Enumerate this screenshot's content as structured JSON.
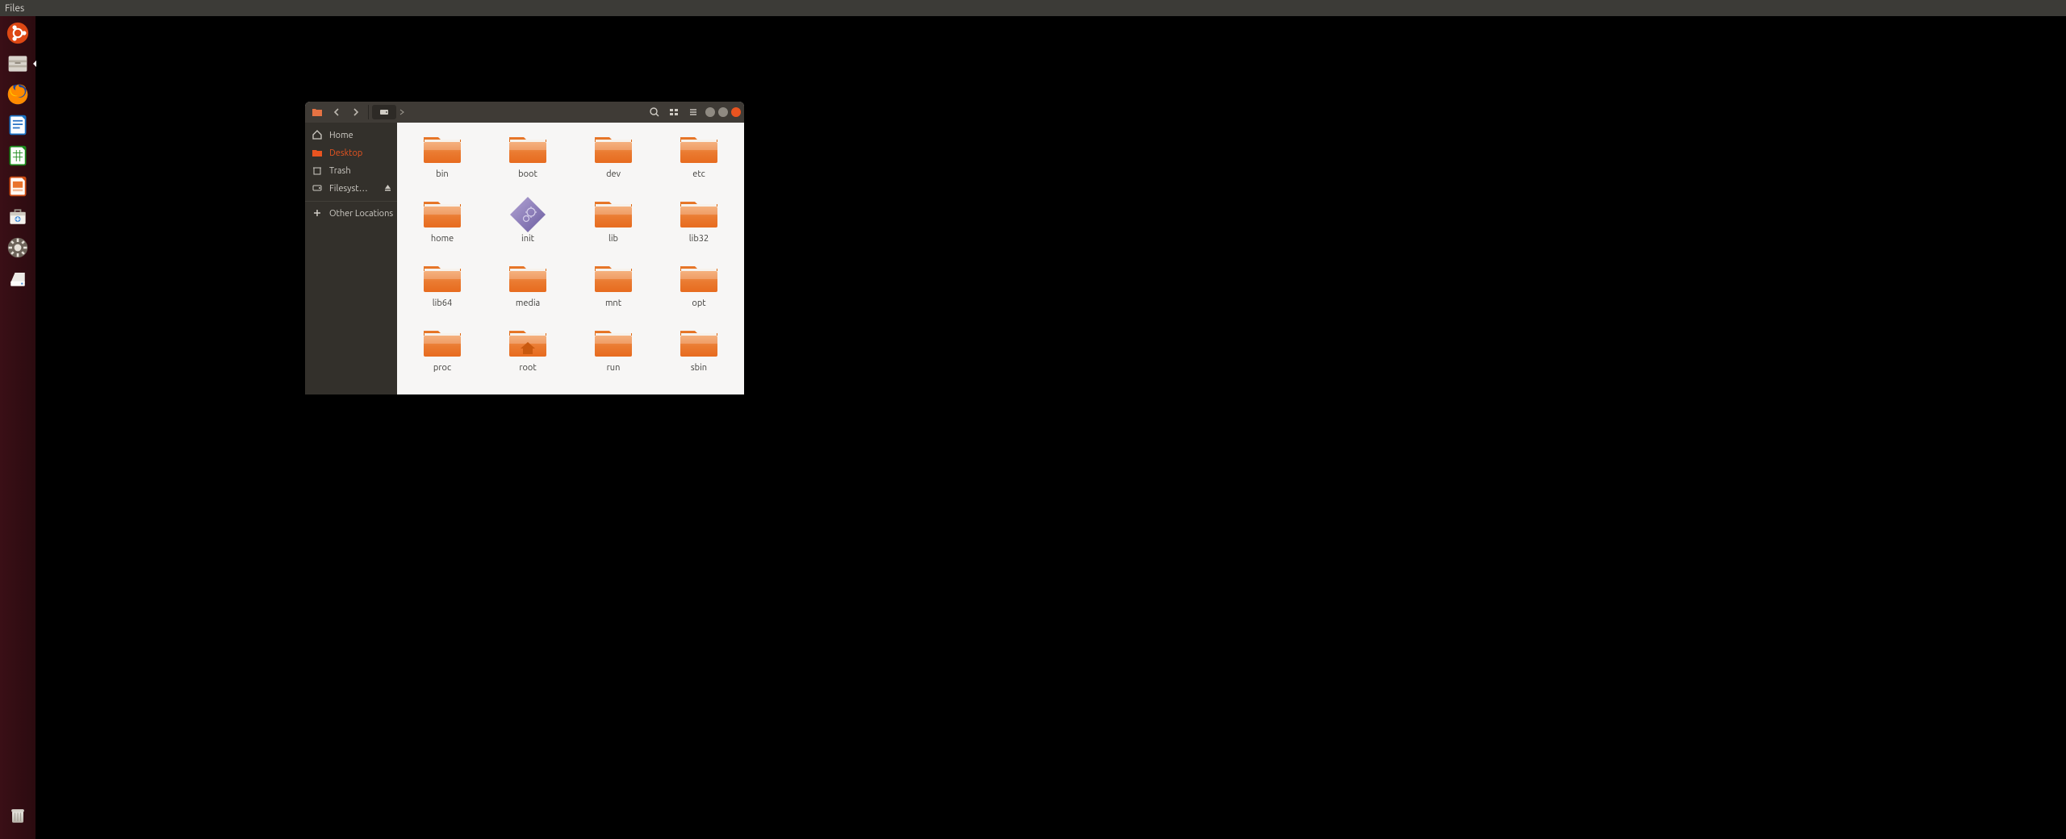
{
  "menubar": {
    "app": "Files"
  },
  "launcher": {
    "items": [
      {
        "name": "ubuntu-dash"
      },
      {
        "name": "files",
        "selected": true
      },
      {
        "name": "firefox"
      },
      {
        "name": "libreoffice-writer"
      },
      {
        "name": "libreoffice-calc"
      },
      {
        "name": "libreoffice-impress"
      },
      {
        "name": "ubuntu-software"
      },
      {
        "name": "settings"
      },
      {
        "name": "disk"
      }
    ],
    "bottom": {
      "name": "trash"
    }
  },
  "fm": {
    "sidebar": {
      "items": [
        {
          "icon": "home",
          "label": "Home"
        },
        {
          "icon": "desktop",
          "label": "Desktop",
          "active": true
        },
        {
          "icon": "trash",
          "label": "Trash"
        },
        {
          "icon": "drive",
          "label": "Filesyst…",
          "eject": true
        },
        {
          "icon": "plus",
          "label": "Other Locations"
        }
      ]
    },
    "folders": [
      {
        "label": "bin",
        "kind": "folder"
      },
      {
        "label": "boot",
        "kind": "folder"
      },
      {
        "label": "dev",
        "kind": "folder"
      },
      {
        "label": "etc",
        "kind": "folder"
      },
      {
        "label": "home",
        "kind": "folder"
      },
      {
        "label": "init",
        "kind": "exec"
      },
      {
        "label": "lib",
        "kind": "folder"
      },
      {
        "label": "lib32",
        "kind": "folder"
      },
      {
        "label": "lib64",
        "kind": "folder"
      },
      {
        "label": "media",
        "kind": "folder"
      },
      {
        "label": "mnt",
        "kind": "folder"
      },
      {
        "label": "opt",
        "kind": "folder"
      },
      {
        "label": "proc",
        "kind": "folder"
      },
      {
        "label": "root",
        "kind": "home"
      },
      {
        "label": "run",
        "kind": "folder"
      },
      {
        "label": "sbin",
        "kind": "folder"
      }
    ],
    "window_controls": {
      "min_color": "#8f8a82",
      "max_color": "#8f8a82",
      "close_color": "#e95420"
    }
  }
}
